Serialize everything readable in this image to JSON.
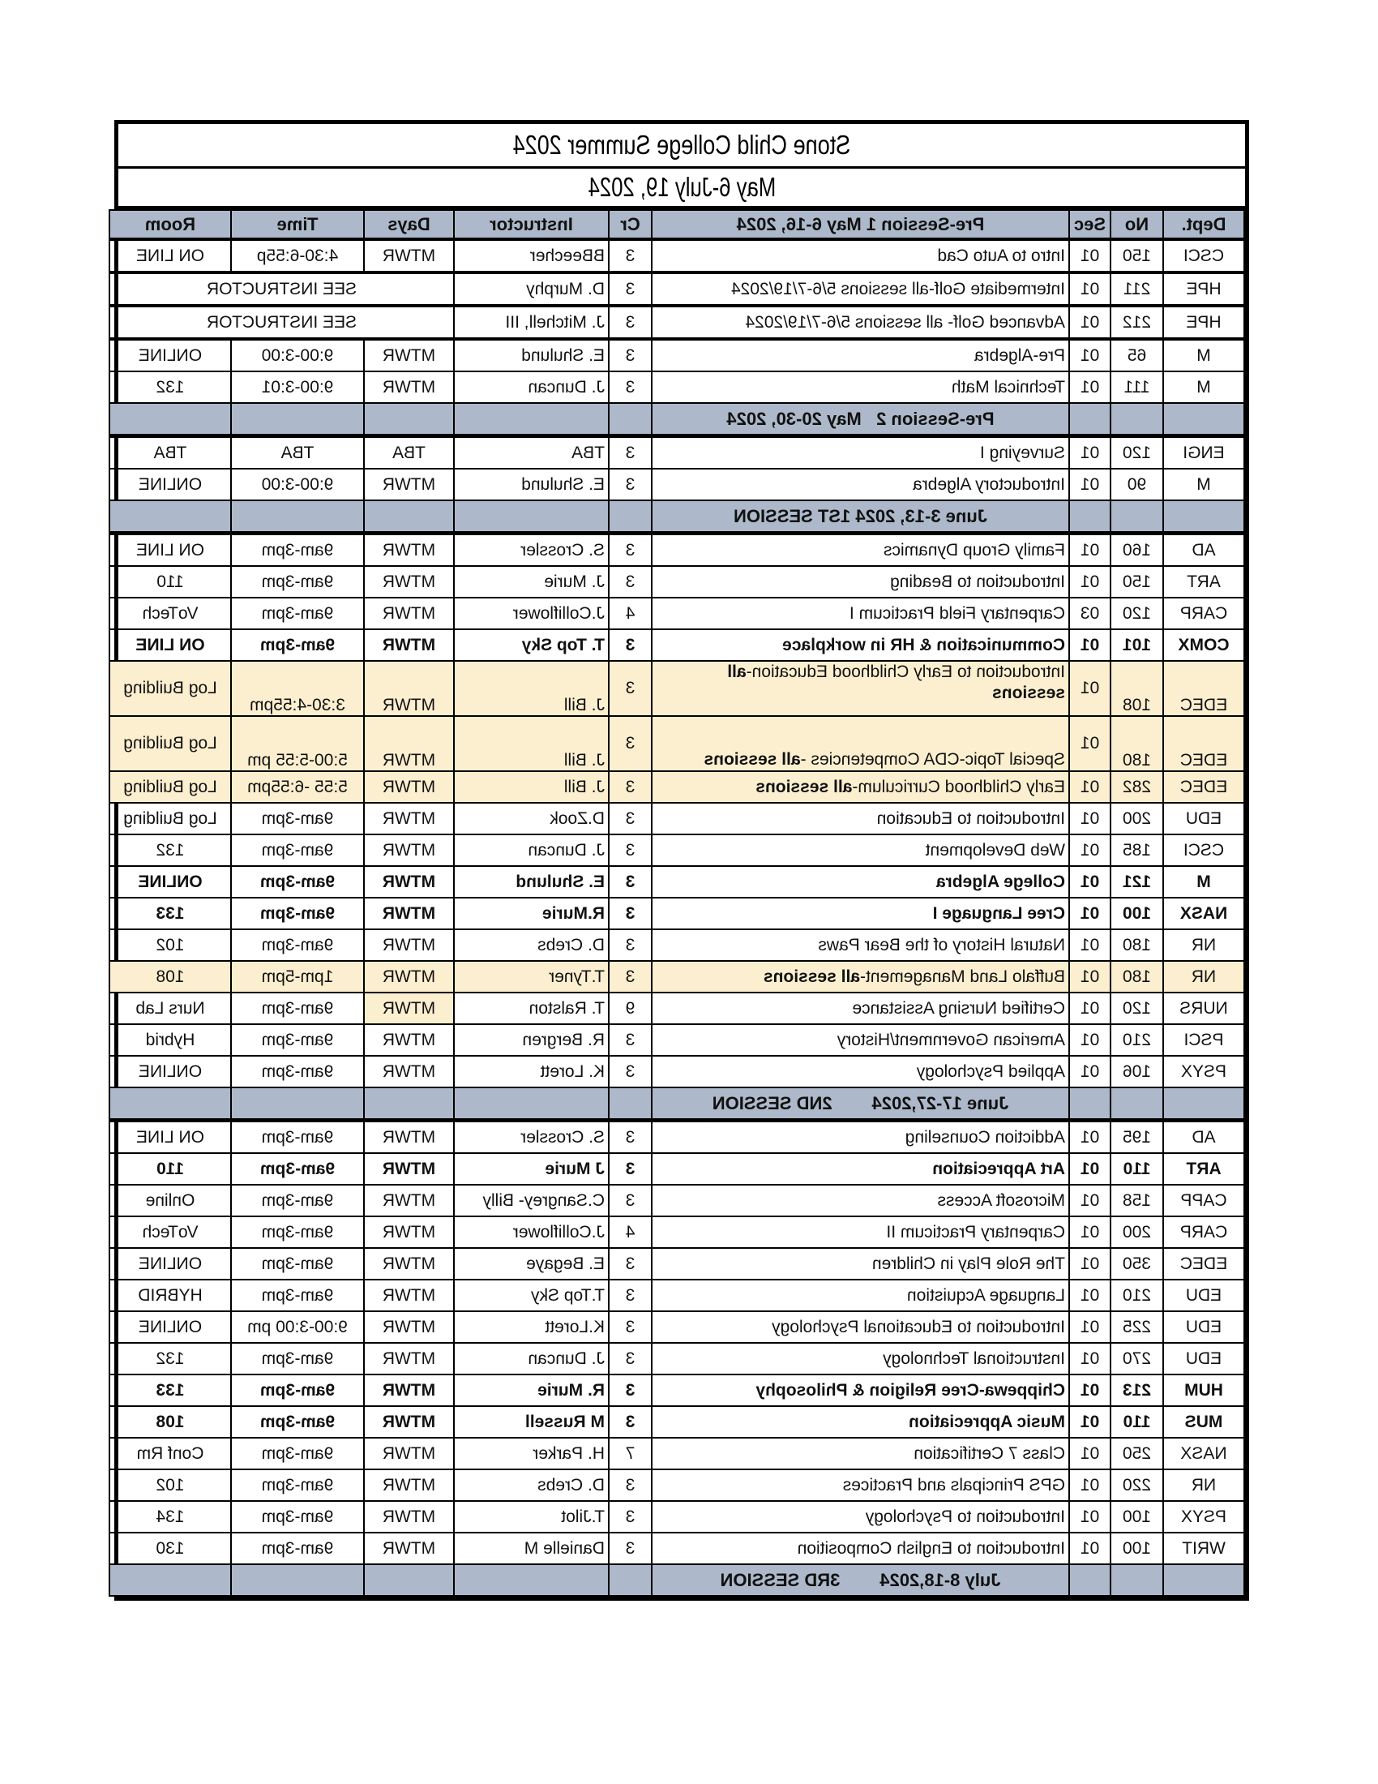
{
  "document": {
    "title": "Stone Child College Summer 2024",
    "date_range": "May 6-July 19, 2024"
  },
  "table": {
    "headers": {
      "dept": "Dept.",
      "no": "No",
      "sec": "Sec",
      "course": "Pre-Session 1 May 6-16, 2024",
      "cr": "Cr",
      "instructor": "Instructor",
      "days": "Days",
      "time": "Time",
      "room": "Room"
    },
    "colors": {
      "header_bg": "#adb9ca",
      "highlight_bg": "#fcefcf",
      "border": "#000000"
    },
    "presession1": [
      {
        "dept": "CSCI",
        "no": "150",
        "sec": "01",
        "course": "Intro to Auto Cad",
        "cr": "3",
        "instructor": "BBeecher",
        "days": "MTWR",
        "time": "4:30-6:55p",
        "room": "ON LINE"
      },
      {
        "dept": "HPE",
        "no": "211",
        "sec": "01",
        "course": "Intermediate Golf-all sessions 5/6-7/19/2024",
        "cr": "3",
        "instructor": "D. Murphy",
        "span_note": "SEE INSTRUCTOR"
      },
      {
        "dept": "HPE",
        "no": "212",
        "sec": "01",
        "course": "Advanced Golf- all sessions 5/6-7/19/2024",
        "cr": "3",
        "instructor": "J. Mitchell, III",
        "span_note": "SEE INSTRUCTOR"
      },
      {
        "dept": "M",
        "no": "65",
        "sec": "01",
        "course": "Pre-Algebra",
        "cr": "3",
        "instructor": "E. Shulund",
        "days": "MTWR",
        "time": "9:00-3:00",
        "room": "ONLINE"
      },
      {
        "dept": "M",
        "no": "111",
        "sec": "01",
        "course": "Technical Math",
        "cr": "3",
        "instructor": "J. Duncan",
        "days": "MTWR",
        "time": "9:00-3:01",
        "room": "132"
      }
    ],
    "presession2": {
      "label": "Pre-Session 2   May 20-30, 2024",
      "rows": [
        {
          "dept": "ENGI",
          "no": "120",
          "sec": "01",
          "course": "Surveying I",
          "cr": "3",
          "instructor": "TBA",
          "days": "TBA",
          "time": "TBA",
          "room": "TBA"
        },
        {
          "dept": "M",
          "no": "90",
          "sec": "01",
          "course": "Introductory Algebra",
          "cr": "3",
          "instructor": "E. Shulund",
          "days": "MTWR",
          "time": "9:00-3:00",
          "room": "ONLINE"
        }
      ]
    },
    "session1": {
      "label": "June 3-13, 2024 1ST SESSION",
      "rows": [
        {
          "dept": "AD",
          "no": "160",
          "sec": "01",
          "course": "Family Group Dynamics",
          "cr": "3",
          "instructor": "S. Crossler",
          "days": "MTWR",
          "time": "9am-3pm",
          "room": "ON LINE"
        },
        {
          "dept": "ART",
          "no": "150",
          "sec": "01",
          "course": "Introduction to Beading",
          "cr": "3",
          "instructor": "J. Murie",
          "days": "MTWR",
          "time": "9am-3pm",
          "room": "110"
        },
        {
          "dept": "CARP",
          "no": "120",
          "sec": "03",
          "course": "Carpentary Field Practicum I",
          "cr": "4",
          "instructor": "J.Colliflower",
          "days": "MTWR",
          "time": "9am-3pm",
          "room": "VoTech"
        },
        {
          "dept": "COMX",
          "no": "101",
          "sec": "01",
          "course": "Communication & HR in workplace",
          "cr": "3",
          "instructor": "T. Top Sky",
          "days": "MTWR",
          "time": "9am-3pm",
          "room": "ON LINE",
          "bold": true
        },
        {
          "dept": "EDEC",
          "no": "108",
          "sec": "01",
          "course": "Introduction to Early Childhood Education-",
          "course_bold": "all sessions",
          "cr": "3",
          "instructor": "J. Bill",
          "days": "MTWR",
          "time": "3:30-4:55pm",
          "room": "Log Building",
          "highlight": true
        },
        {
          "dept": "EDEC",
          "no": "180",
          "sec": "01",
          "course": "Special Topic-CDA Competencies -",
          "course_bold": "all sessions",
          "cr": "3",
          "instructor": "J. Bill",
          "days": "MTWR",
          "time": "5:00-5:55 pm",
          "room": "Log Building",
          "highlight": true
        },
        {
          "dept": "EDEC",
          "no": "282",
          "sec": "01",
          "course": "Early Childhood Curriculum-",
          "course_bold": "all sessions",
          "cr": "3",
          "instructor": "J. Bill",
          "days": "MTWR",
          "time": "5:55 -6:55pm",
          "room": "Log Building",
          "highlight": true
        },
        {
          "dept": "EDU",
          "no": "200",
          "sec": "01",
          "course": "Introduction to Education",
          "cr": "3",
          "instructor": "D.Zook",
          "days": "MTWR",
          "time": "9am-3pm",
          "room": "Log Building"
        },
        {
          "dept": "CSCI",
          "no": "185",
          "sec": "01",
          "course": "Web Development",
          "cr": "3",
          "instructor": "J. Duncan",
          "days": "MTWR",
          "time": "9am-3pm",
          "room": "132"
        },
        {
          "dept": "M",
          "no": "121",
          "sec": "01",
          "course": "College Algebra",
          "cr": "3",
          "instructor": "E. Shulund",
          "days": "MTWR",
          "time": "9am-3pm",
          "room": "ONLINE",
          "bold": true
        },
        {
          "dept": "NASX",
          "no": "100",
          "sec": "01",
          "course": "Cree Language I",
          "cr": "3",
          "instructor": "R.Murie",
          "days": "MTWR",
          "time": "9am-3pm",
          "room": "133",
          "bold": true
        },
        {
          "dept": "NR",
          "no": "180",
          "sec": "01",
          "course": "Natural History of the Bear Paws",
          "cr": "3",
          "instructor": "D. Crebs",
          "days": "MTWR",
          "time": "9am-3pm",
          "room": "102"
        },
        {
          "dept": "NR",
          "no": "180",
          "sec": "01",
          "course": "Buffalo Land Management-",
          "course_bold": "all sessions",
          "cr": "3",
          "instructor": "T.Tyner",
          "days": "MTWR",
          "time": "1pm-5pm",
          "room": "108",
          "highlight": true
        },
        {
          "dept": "NURS",
          "no": "120",
          "sec": "01",
          "course": "Certified Nursing Assistance",
          "cr": "9",
          "instructor": "T. Ralston",
          "days": "MTWR",
          "time": "9am-3pm",
          "room": "Nurs Lab",
          "days_highlight": true
        },
        {
          "dept": "PSCI",
          "no": "210",
          "sec": "01",
          "course": "American Government/History",
          "cr": "3",
          "instructor": "R. Bergren",
          "days": "MTWR",
          "time": "9am-3pm",
          "room": "Hybrid"
        },
        {
          "dept": "PSYX",
          "no": "106",
          "sec": "01",
          "course": "Applied Psychology",
          "cr": "3",
          "instructor": "K. Lorett",
          "days": "MTWR",
          "time": "9am-3pm",
          "room": "ONLINE"
        }
      ]
    },
    "session2": {
      "label": "June 17-27,2024        2ND SESSION",
      "rows": [
        {
          "dept": "AD",
          "no": "195",
          "sec": "01",
          "course": "Addiction Counseling",
          "cr": "3",
          "instructor": "S. Crossler",
          "days": "MTWR",
          "time": "9am-3pm",
          "room": "ON LINE"
        },
        {
          "dept": "ART",
          "no": "110",
          "sec": "01",
          "course": "Art Appreciation",
          "cr": "3",
          "instructor": "J Murie",
          "days": "MTWR",
          "time": "9am-3pm",
          "room": "110",
          "bold": true
        },
        {
          "dept": "CAPP",
          "no": "158",
          "sec": "01",
          "course": "Microsoft Access",
          "cr": "3",
          "instructor": "C.Sangrey- Billy",
          "days": "MTWR",
          "time": "9am-3pm",
          "room": "Online"
        },
        {
          "dept": "CARP",
          "no": "200",
          "sec": "01",
          "course": "Carpentary Practicum II",
          "cr": "4",
          "instructor": "J.Colliflower",
          "days": "MTWR",
          "time": "9am-3pm",
          "room": "VoTech"
        },
        {
          "dept": "EDEC",
          "no": "350",
          "sec": "01",
          "course": "The Role Play in Children",
          "cr": "3",
          "instructor": "E. Begaye",
          "days": "MTWR",
          "time": "9am-3pm",
          "room": "ONLINE"
        },
        {
          "dept": "EDU",
          "no": "210",
          "sec": "01",
          "course": "Language Acquistion",
          "cr": "3",
          "instructor": "T.Top Sky",
          "days": "MTWR",
          "time": "9am-3pm",
          "room": "HYBRID"
        },
        {
          "dept": "EDU",
          "no": "225",
          "sec": "01",
          "course": "Introduction to Educational Psychology",
          "cr": "3",
          "instructor": "K.Lorett",
          "days": "MTWR",
          "time": "9:00-3:00 pm",
          "room": "ONLINE"
        },
        {
          "dept": "EDU",
          "no": "270",
          "sec": "01",
          "course": "Instructional Technology",
          "cr": "3",
          "instructor": "J. Duncan",
          "days": "MTWR",
          "time": "9am-3pm",
          "room": "132"
        },
        {
          "dept": "HUM",
          "no": "213",
          "sec": "01",
          "course": "Chippewa-Cree Religion & Philosophy",
          "cr": "3",
          "instructor": "R. Murie",
          "days": "MTWR",
          "time": "9am-3pm",
          "room": "133",
          "bold": true
        },
        {
          "dept": "MUS",
          "no": "110",
          "sec": "01",
          "course": "Music Appreciation",
          "cr": "3",
          "instructor": "M Russell",
          "days": "MTWR",
          "time": "9am-3pm",
          "room": "108",
          "bold": true
        },
        {
          "dept": "NASX",
          "no": "250",
          "sec": "01",
          "course": "Class 7 Certification",
          "cr": "7",
          "instructor": "H. Parker",
          "days": "MTWR",
          "time": "9am-3pm",
          "room": "Conf Rm"
        },
        {
          "dept": "NR",
          "no": "220",
          "sec": "01",
          "course": "GPS Principals and Practices",
          "cr": "3",
          "instructor": "D. Crebs",
          "days": "MTWR",
          "time": "9am-3pm",
          "room": "102"
        },
        {
          "dept": "PSYX",
          "no": "100",
          "sec": "01",
          "course": "Introduction to Psychology",
          "cr": "3",
          "instructor": "T.Jilot",
          "days": "MTWR",
          "time": "9am-3pm",
          "room": "134"
        },
        {
          "dept": "WRIT",
          "no": "100",
          "sec": "01",
          "course": "Introduction to English Composition",
          "cr": "3",
          "instructor": "Danielle M",
          "days": "MTWR",
          "time": "9am-3pm",
          "room": "130"
        }
      ]
    },
    "session3": {
      "label": "July 8-18,2024        3RD SESSION"
    }
  }
}
